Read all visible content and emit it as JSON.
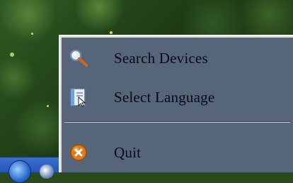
{
  "context_menu": {
    "items": [
      {
        "label": "Search Devices",
        "icon": "magnifier-icon"
      },
      {
        "label": "Select Language",
        "icon": "language-book-icon"
      },
      {
        "label": "Quit",
        "icon": "quit-icon"
      }
    ]
  },
  "colors": {
    "menu_background": "#56657a",
    "menu_border": "#dcdcdc",
    "label_text": "#0a0a14",
    "quit_icon": "#e07a1a"
  }
}
